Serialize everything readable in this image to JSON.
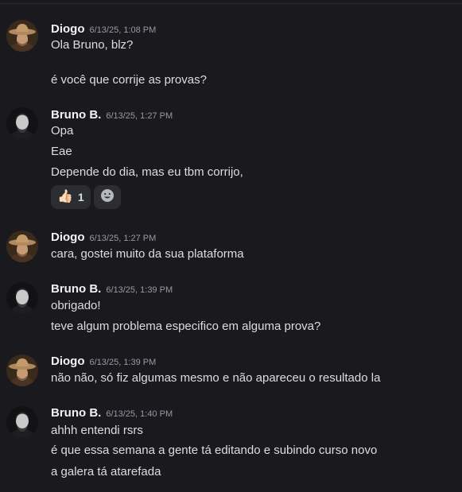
{
  "messages": [
    {
      "author": "Diogo",
      "timestamp": "6/13/25, 1:08 PM",
      "avatar": "cowboy-avatar",
      "lines": [
        "Ola Bruno, blz?",
        "é você que corrije as provas?"
      ]
    },
    {
      "author": "Bruno B.",
      "timestamp": "6/13/25, 1:27 PM",
      "avatar": "bearded-man-avatar",
      "lines": [
        "Opa",
        "Eae",
        "Depende do dia, mas eu tbm corrijo,"
      ],
      "reactions": [
        {
          "emoji": "👍🏻",
          "icon": "thumbs-up-icon",
          "count": "1"
        }
      ],
      "add_reaction_icon": "smiley-add-reaction-icon"
    },
    {
      "author": "Diogo",
      "timestamp": "6/13/25, 1:27 PM",
      "avatar": "cowboy-avatar",
      "lines": [
        "cara, gostei muito da sua plataforma"
      ]
    },
    {
      "author": "Bruno B.",
      "timestamp": "6/13/25, 1:39 PM",
      "avatar": "bearded-man-avatar",
      "lines": [
        "obrigado!",
        "teve algum problema especifico em alguma prova?"
      ]
    },
    {
      "author": "Diogo",
      "timestamp": "6/13/25, 1:39 PM",
      "avatar": "cowboy-avatar",
      "lines": [
        "não não, só fiz algumas mesmo e não apareceu o resultado la"
      ]
    },
    {
      "author": "Bruno B.",
      "timestamp": "6/13/25, 1:40 PM",
      "avatar": "bearded-man-avatar",
      "lines": [
        "ahhh entendi rsrs",
        "é que essa semana a gente tá editando e subindo curso novo",
        "a galera tá atarefada"
      ]
    }
  ],
  "colors": {
    "background": "#1a1a1e",
    "author": "#f2f3f5",
    "timestamp": "#949ba4",
    "text": "#dbdee1",
    "reaction_bg": "#2b2d31"
  }
}
